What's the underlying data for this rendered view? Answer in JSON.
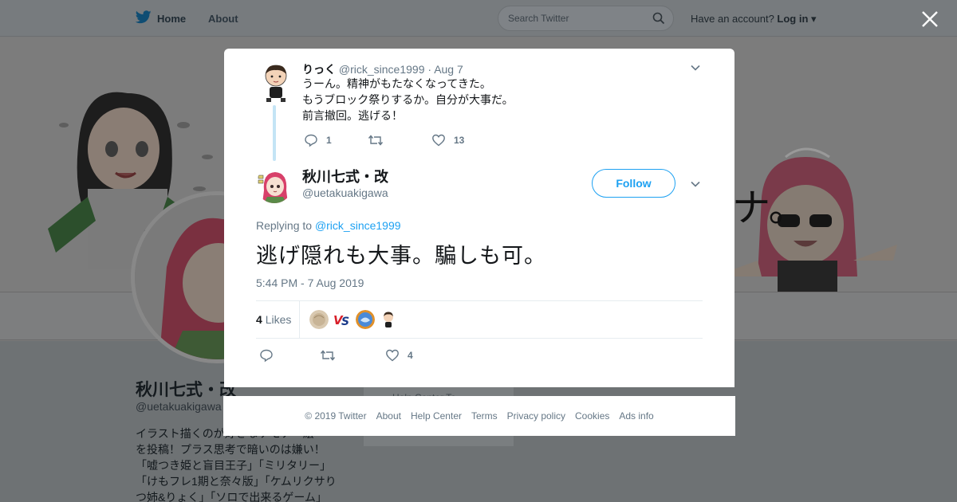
{
  "topnav": {
    "home_label": "Home",
    "about_label": "About",
    "search_placeholder": "Search Twitter",
    "account_prompt": "Have an account?",
    "login_label": "Log in"
  },
  "background_profile": {
    "name": "秋川七式・改",
    "handle": "@uetakuakigawa",
    "bio_lines": [
      "イラスト描くのが好きなケモナー絵",
      "を投稿！プラス思考で暗いのは嫌い！",
      "「嘘つき姫と盲目王子」「ミリタリー」",
      "「けもフレ1期と奈々版」「ケムリクサり",
      "つ姉&りょく」「ソロで出来るゲーム」"
    ],
    "help_card_text": "Help Center  Te"
  },
  "parent_tweet": {
    "name": "りっく",
    "handle": "@rick_since1999",
    "separator": "·",
    "date": "Aug 7",
    "lines": [
      "うーん。精神がもたなくなってきた。",
      "もうブロック祭りするか。自分が大事だ。",
      "前言撤回。逃げる！"
    ],
    "reply_count": "1",
    "like_count": "13"
  },
  "main_tweet": {
    "name": "秋川七式・改",
    "handle": "@uetakuakigawa",
    "follow_label": "Follow",
    "replying_prefix": "Replying to",
    "replying_to": "@rick_since1999",
    "text": "逃げ隠れも大事。騙しも可。",
    "timestamp": "5:44 PM - 7 Aug 2019",
    "likes_number": "4",
    "likes_label": "Likes",
    "action_like_count": "4"
  },
  "footer": {
    "copyright": "© 2019 Twitter",
    "links": [
      "About",
      "Help Center",
      "Terms",
      "Privacy policy",
      "Cookies",
      "Ads info"
    ]
  },
  "colors": {
    "accent": "#1da1f2",
    "secondary_text": "#657786",
    "thread_line": "#c4e4f5",
    "overlay_bg": "#7a7a7a"
  }
}
